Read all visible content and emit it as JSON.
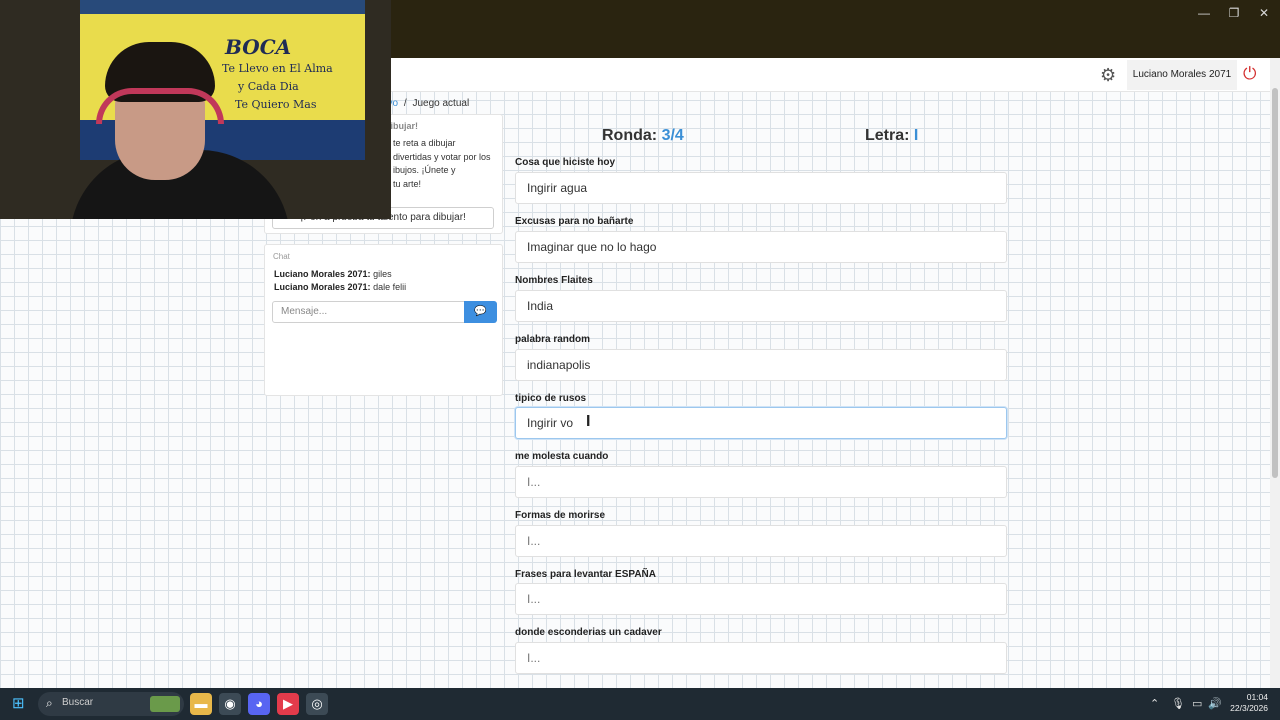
{
  "browser": {
    "window_controls": [
      "—",
      "❐",
      "✕"
    ],
    "toolbar_icons": [
      "star-icon",
      "extensions-icon",
      "profile-icon",
      "menu-icon"
    ]
  },
  "header": {
    "user_name": "Luciano Morales 2071"
  },
  "breadcrumb": {
    "link": "evo",
    "separator": "/",
    "current": "Juego actual"
  },
  "intro": {
    "title": "dibujar!",
    "lines": [
      "te reta a dibujar",
      "divertidas y votar por los",
      "ibujos. ¡Únete y",
      "tu arte!"
    ],
    "button_label": "¡Pon a prueba tu talento para dibujar!"
  },
  "chat": {
    "title": "Chat",
    "messages": [
      {
        "user": "Luciano Morales 2071:",
        "text": "giles"
      },
      {
        "user": "Luciano Morales 2071:",
        "text": "dale felii"
      }
    ],
    "input_placeholder": "Mensaje...",
    "send_icon": "chat-bubble-icon"
  },
  "game": {
    "ronda_label": "Ronda:",
    "ronda_value": "3/4",
    "letra_label": "Letra:",
    "letra_value": "I"
  },
  "fields": [
    {
      "label": "Cosa que hiciste hoy",
      "value": "Ingirir agua"
    },
    {
      "label": "Excusas para no bañarte",
      "value": "Imaginar que no lo hago"
    },
    {
      "label": "Nombres Flaites",
      "value": "India"
    },
    {
      "label": "palabra random",
      "value": "indianapolis"
    },
    {
      "label": "tipico de rusos",
      "value": "Ingirir vo"
    },
    {
      "label": "me molesta cuando",
      "placeholder": "I..."
    },
    {
      "label": "Formas de morirse",
      "placeholder": "I..."
    },
    {
      "label": "Frases para levantar ESPAÑA",
      "placeholder": "I..."
    },
    {
      "label": "donde esconderias un cadaver",
      "placeholder": "I..."
    }
  ],
  "webcam": {
    "banner_word": "BOCA",
    "banner_lines": [
      "Te Llevo en El Alma",
      "y Cada Dia",
      "Te Quiero Mas"
    ]
  },
  "taskbar": {
    "search_placeholder": "Buscar",
    "time": "01:04",
    "date": "22/3/2026"
  }
}
